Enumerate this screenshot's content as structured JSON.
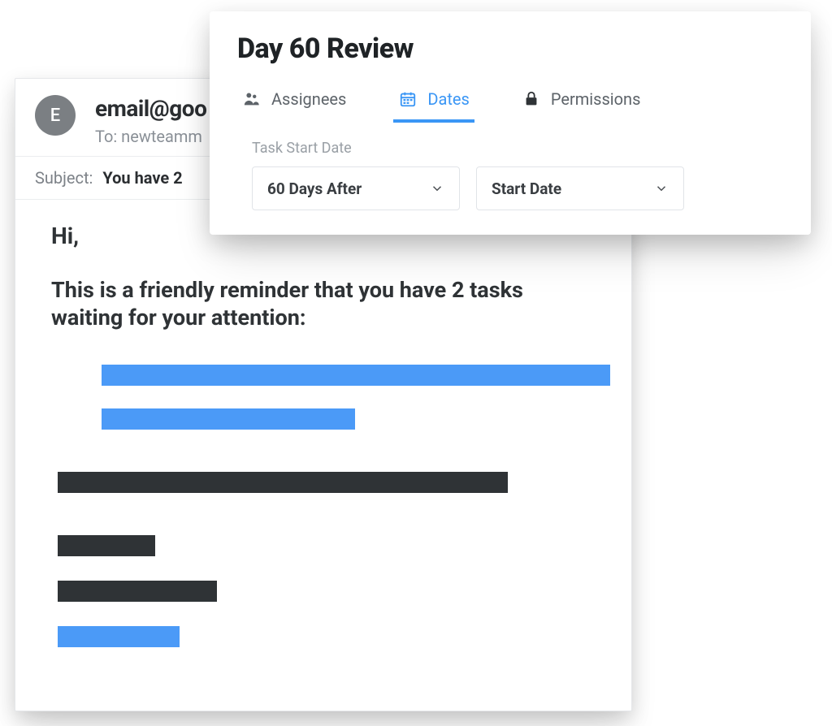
{
  "email": {
    "avatar_letter": "E",
    "from": "email@goo",
    "to_label": "To: newteamm",
    "subject_label": "Subject:",
    "subject_text": "You have 2",
    "greeting": "Hi,",
    "intro": "This is a friendly reminder that you have 2 tasks waiting for your attention:"
  },
  "modal": {
    "title": "Day 60 Review",
    "tabs": {
      "assignees": "Assignees",
      "dates": "Dates",
      "permissions": "Permissions"
    },
    "section_label": "Task Start Date",
    "select1": "60 Days After",
    "select2": "Start Date"
  },
  "colors": {
    "accent": "#4b9af7",
    "dark": "#2f3336"
  }
}
